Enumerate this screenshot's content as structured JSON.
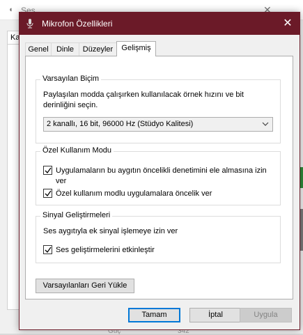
{
  "background_window": {
    "title": "Ses",
    "tab_label": "Ka",
    "bottom_label": "Güç",
    "bottom_value": "342",
    "right_labels": [
      "2",
      "/",
      "2",
      "/"
    ],
    "colors": {
      "titlebar": "#ffffff",
      "accent_green": "#2e8b3a"
    }
  },
  "dialog": {
    "title": "Mikrofon Özellikleri",
    "close_glyph": "✕",
    "colors": {
      "titlebar": "#6b1a28",
      "primary_border": "#0078d7"
    },
    "tabs": [
      {
        "label": "Genel",
        "active": false
      },
      {
        "label": "Dinle",
        "active": false
      },
      {
        "label": "Düzeyler",
        "active": false
      },
      {
        "label": "Gelişmiş",
        "active": true
      }
    ],
    "default_format": {
      "legend": "Varsayılan Biçim",
      "description": "Paylaşılan modda çalışırken kullanılacak örnek hızını ve bit derinliğini seçin.",
      "selected": "2 kanallı, 16 bit, 96000 Hz (Stüdyo Kalitesi)"
    },
    "exclusive_mode": {
      "legend": "Özel Kullanım Modu",
      "option1": {
        "label": "Uygulamaların bu aygıtın öncelikli denetimini ele almasına izin ver",
        "checked": true
      },
      "option2": {
        "label": "Özel kullanım modlu uygulamalara öncelik ver",
        "checked": true
      }
    },
    "signal_enhancements": {
      "legend": "Sinyal Geliştirmeleri",
      "description": "Ses aygıtıyla ek sinyal işlemeye izin ver",
      "option1": {
        "label": "Ses geliştirmelerini etkinleştir",
        "checked": true
      }
    },
    "restore_defaults_label": "Varsayılanları Geri Yükle",
    "buttons": {
      "ok": "Tamam",
      "cancel": "İptal",
      "apply": "Uygula"
    }
  }
}
